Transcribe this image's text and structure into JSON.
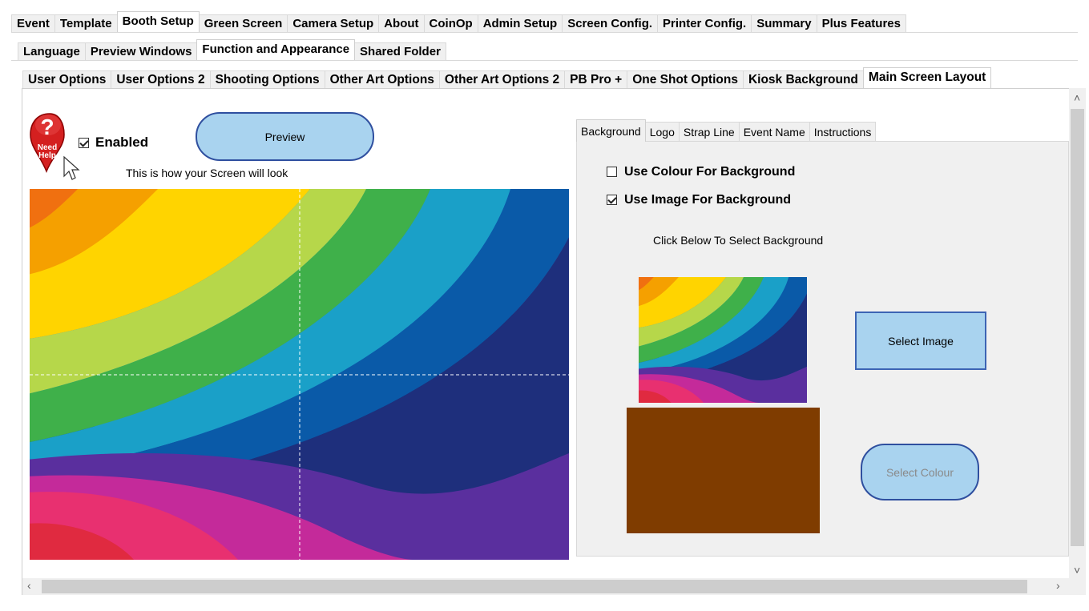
{
  "main_tabs": [
    "Event",
    "Template",
    "Booth Setup",
    "Green Screen",
    "Camera Setup",
    "About",
    "CoinOp",
    "Admin Setup",
    "Screen Config.",
    "Printer Config.",
    "Summary",
    "Plus Features"
  ],
  "main_tabs_active": "Booth Setup",
  "sub_tabs": [
    "Language",
    "Preview Windows",
    "Function and Appearance",
    "Shared Folder"
  ],
  "sub_tabs_active": "Function and Appearance",
  "section_tabs": [
    "User Options",
    "User Options 2",
    "Shooting Options",
    "Other Art Options",
    "Other Art Options 2",
    "PB Pro +",
    "One Shot Options",
    "Kiosk Background",
    "Main Screen Layout"
  ],
  "section_tabs_active": "Main Screen Layout",
  "help": {
    "line1": "Need",
    "line2": "Help"
  },
  "enabled": {
    "label": "Enabled",
    "checked": true
  },
  "preview_button": "Preview",
  "caption": "This is how your Screen will look",
  "layout_tabs": [
    "Background",
    "Logo",
    "Strap Line",
    "Event Name",
    "Instructions"
  ],
  "layout_tabs_active": "Background",
  "options": {
    "use_colour": {
      "label": "Use Colour For Background",
      "checked": false
    },
    "use_image": {
      "label": "Use Image For Background",
      "checked": true
    }
  },
  "click_below": "Click Below To Select Background",
  "select_image_button": "Select Image",
  "select_colour_button": "Select Colour",
  "colours": {
    "background_colour": "#7f3c00",
    "button_fill": "#a9d3ef",
    "button_border": "#2f4f9f"
  }
}
